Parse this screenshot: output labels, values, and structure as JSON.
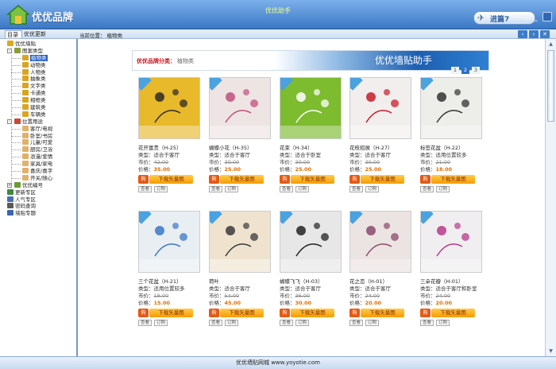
{
  "window": {
    "title": "优优助手",
    "brand": "优优品牌",
    "enter_label": "进篇7",
    "watermark": "yoyotie.com"
  },
  "tabs": {
    "catalog": "目录",
    "updates": "优优更新"
  },
  "breadcrumb": "当前位置： 植物类",
  "nav_buttons": [
    "‹",
    "›",
    "✕"
  ],
  "tree": [
    {
      "label": "优优墙贴",
      "level": 0,
      "toggle": "",
      "icon": "crown-icon",
      "color": "#e2a81a"
    },
    {
      "label": "图案类型",
      "level": 0,
      "toggle": "-",
      "icon": "folder-icon",
      "color": "#8a9c3a"
    },
    {
      "label": "植物类",
      "level": 1,
      "selected": true,
      "icon": "leaf-icon",
      "color": "#d9a521"
    },
    {
      "label": "动物类",
      "level": 1,
      "icon": "leaf-icon",
      "color": "#d9a521"
    },
    {
      "label": "人物类",
      "level": 1,
      "icon": "leaf-icon",
      "color": "#d9a521"
    },
    {
      "label": "抽象类",
      "level": 1,
      "icon": "leaf-icon",
      "color": "#d9a521"
    },
    {
      "label": "文字类",
      "level": 1,
      "icon": "leaf-icon",
      "color": "#d9a521"
    },
    {
      "label": "卡通类",
      "level": 1,
      "icon": "leaf-icon",
      "color": "#d9a521"
    },
    {
      "label": "相框类",
      "level": 1,
      "icon": "leaf-icon",
      "color": "#d9a521"
    },
    {
      "label": "建筑类",
      "level": 1,
      "icon": "leaf-icon",
      "color": "#d9a521"
    },
    {
      "label": "车辆类",
      "level": 1,
      "icon": "leaf-icon",
      "color": "#d9a521"
    },
    {
      "label": "位置用途",
      "level": 0,
      "toggle": "-",
      "icon": "home-icon",
      "color": "#c84a35"
    },
    {
      "label": "客厅/电视",
      "level": 1,
      "icon": "leaf-icon",
      "color": "#e0b16a"
    },
    {
      "label": "卧室/书房",
      "level": 1,
      "icon": "leaf-icon",
      "color": "#e0b16a"
    },
    {
      "label": "儿童/可爱",
      "level": 1,
      "icon": "leaf-icon",
      "color": "#e0b16a"
    },
    {
      "label": "厨房/卫浴",
      "level": 1,
      "icon": "leaf-icon",
      "color": "#e0b16a"
    },
    {
      "label": "浪漫/爱情",
      "level": 1,
      "icon": "leaf-icon",
      "color": "#e0b16a"
    },
    {
      "label": "家具/家电",
      "level": 1,
      "icon": "leaf-icon",
      "color": "#e0b16a"
    },
    {
      "label": "喜庆/喜字",
      "level": 1,
      "icon": "leaf-icon",
      "color": "#e0b16a"
    },
    {
      "label": "开关/随心",
      "level": 1,
      "icon": "leaf-icon",
      "color": "#e0b16a"
    },
    {
      "label": "优优编号",
      "level": 0,
      "toggle": "+",
      "icon": "tag-icon",
      "color": "#6b9b35"
    },
    {
      "label": "更新专区",
      "level": 0,
      "toggle": "",
      "icon": "refresh-icon",
      "color": "#3b8a3b"
    },
    {
      "label": "人气专区",
      "level": 0,
      "toggle": "",
      "icon": "people-icon",
      "color": "#4a6fb0"
    },
    {
      "label": "密码查询",
      "level": 0,
      "toggle": "",
      "icon": "key-icon",
      "color": "#5a5a5a"
    },
    {
      "label": "墙贴专题",
      "level": 0,
      "toggle": "",
      "icon": "book-icon",
      "color": "#3b66b0"
    }
  ],
  "banner": {
    "category_label": "优优品牌分类：",
    "category_value": "植物类",
    "title": "优优墙贴助手"
  },
  "pager": [
    "1",
    "2",
    "3"
  ],
  "labels": {
    "type": "类型：",
    "market": "市价：",
    "price": "价格：",
    "download": "下载矢量图",
    "cart": "购",
    "view": "查看",
    "order": "订购"
  },
  "products": [
    {
      "name": "花开富贵（H-25）",
      "type": "适合于客厅",
      "market": "42.00",
      "price": "35.00",
      "bg": "#e8b92b",
      "accent": "#2e2a26"
    },
    {
      "name": "蝴蝶小花（H-35）",
      "type": "适合于客厅",
      "market": "30.00",
      "price": "25.00",
      "bg": "#efe4e4",
      "accent": "#c0507a"
    },
    {
      "name": "花束（H-34）",
      "type": "适合于卧室",
      "market": "30.00",
      "price": "25.00",
      "bg": "#7dbb2f",
      "accent": "#ffffff"
    },
    {
      "name": "花枝招展（H-27）",
      "type": "适合于客厅",
      "market": "30.00",
      "price": "25.00",
      "bg": "#f3eeee",
      "accent": "#c81c2a"
    },
    {
      "name": "标签花盆（H-22）",
      "type": "适用位置较多",
      "market": "21.00",
      "price": "18.00",
      "bg": "#ededea",
      "accent": "#333333"
    },
    {
      "name": "三个花盆（H-21）",
      "type": "适用位置较多",
      "market": "18.00",
      "price": "15.00",
      "bg": "#e9eef2",
      "accent": "#3b77c9"
    },
    {
      "name": "荷叶",
      "type": "适合于客厅",
      "market": "54.00",
      "price": "45.00",
      "bg": "#efe3cf",
      "accent": "#3a3a3a"
    },
    {
      "name": "蝴蝶飞飞（H-03）",
      "type": "适合于客厅",
      "market": "36.00",
      "price": "30.00",
      "bg": "#e7e7e7",
      "accent": "#222222"
    },
    {
      "name": "花之恋（H-01）",
      "type": "适合于客厅",
      "market": "24.00",
      "price": "20.00",
      "bg": "#ece4e2",
      "accent": "#8b4a6e"
    },
    {
      "name": "三朵花瓣（H-01）",
      "type": "适合于客厅和卧室",
      "market": "24.00",
      "price": "20.00",
      "bg": "#f0eef0",
      "accent": "#b83a8a"
    }
  ],
  "status": "优优墙贴网城 www.yoyotie.com"
}
